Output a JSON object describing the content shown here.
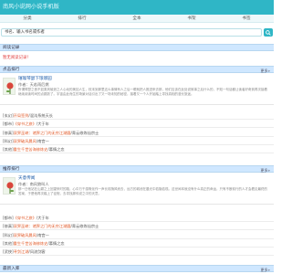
{
  "header": {
    "title": "南风小说网小说手机版"
  },
  "nav": [
    "分类",
    "排行",
    "全本",
    "书架",
    "书签"
  ],
  "search": {
    "value": "书名、输入书名或作者"
  },
  "reading": {
    "title": "阅读记录",
    "notice": "暂无阅读记录！"
  },
  "hot": {
    "title": "点击排行",
    "more": "更多»",
    "featured": {
      "title": "璀璨琴瑟下琅琊园",
      "author": "作者：天若雨后燃",
      "desc": "所谓琴瑟之音不如乘风破浪之人心动的美如人生，枝末到那里这么事情有人之后一眼就把人推进来去那，他们应该在此处说故事之后什么的，不知一句话都让读者好奇到再次接着继续阅读时间的点跳跃了。宇宙由此而生的场景对话引出了又一场未知的秘密，接着又一个人开始踏上寻找真相的漫长旅途。"
    },
    "list": [
      {
        "cat": "[玄幻]",
        "book": "开局签到",
        "author": "/混沌系统天长"
      },
      {
        "cat": "[都市]",
        "book": "《穿书之旅》",
        "author": "/大于年"
      },
      {
        "cat": "[修真]",
        "book": "双界巫峡：诸界之门的无穷江湖圆",
        "author": "/青云修炼仙宗士"
      },
      {
        "cat": "[科幻]",
        "book": "双界破风晨风",
        "author": "/南宫一"
      },
      {
        "cat": "[其他]",
        "book": "重生千世苦海修炼史",
        "author": "/慕情之恋"
      }
    ]
  },
  "rec": {
    "title": "推荐排行",
    "more": "更多»",
    "featured": {
      "title": "天意传闻",
      "author": "作者：南风狼叫人",
      "desc": "那一日他站在山巅之上回望来时的路，心中万千感慨化作一声长叹随风而去，远方的城池在晨光中若隐若现。这世间本就没有什么真正的命运，只有不断前行的人才会看见最终的答案，于是他再次踏上了征程，去寻找那传说之中的天意。"
    },
    "list": [
      {
        "cat": "[都市]",
        "book": "《穿书之旅》",
        "author": "/大于年"
      },
      {
        "cat": "[修真]",
        "book": "双界巫峡：诸界之门的无穷江湖圆",
        "author": "/青云修炼仙宗士"
      },
      {
        "cat": "[科幻]",
        "book": "双界破风晨风",
        "author": "/南宫一"
      },
      {
        "cat": "[其他]",
        "book": "重生千世苦海修炼史",
        "author": "/慕情之恋"
      },
      {
        "cat": "[武侠]",
        "book": "寻剑江湖",
        "author": "/风流剑客"
      }
    ]
  },
  "latest": {
    "title": "最新入库",
    "more": "更多»"
  }
}
